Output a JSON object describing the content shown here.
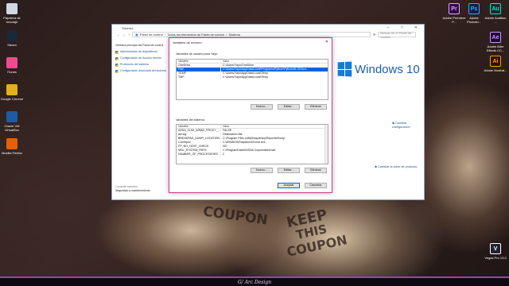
{
  "desktop": {
    "left_icons": [
      {
        "label": "Papelera de reciclaje",
        "icon": "recycle-bin-icon",
        "color": "#cfd8e3"
      },
      {
        "label": "Steam",
        "icon": "steam-icon",
        "color": "#1b2838"
      },
      {
        "label": "iTunes",
        "icon": "itunes-icon",
        "color": "#f04b8f"
      },
      {
        "label": "Google Chrome",
        "icon": "chrome-icon",
        "color": "#e3b21a"
      },
      {
        "label": "Oracle VM VirtualBox",
        "icon": "virtualbox-icon",
        "color": "#1f5aa6"
      },
      {
        "label": "Mozilla Firefox",
        "icon": "firefox-icon",
        "color": "#e66000"
      }
    ],
    "right_icons": [
      {
        "label": "Adobe Premiere P...",
        "glyph": "Pr",
        "color": "#2a0f47",
        "fg": "#e6a0ff"
      },
      {
        "label": "Adobe Photosh...",
        "glyph": "Ps",
        "color": "#0b2441",
        "fg": "#31a8ff"
      },
      {
        "label": "Adobe Audition ...",
        "glyph": "Au",
        "color": "#06332f",
        "fg": "#00e4bb"
      },
      {
        "label": "Adobe After Effects CC...",
        "glyph": "Ae",
        "color": "#1a0b35",
        "fg": "#d291ff"
      },
      {
        "label": "Adobe Illustrat...",
        "glyph": "Ai",
        "color": "#2e1300",
        "fg": "#ff9a00"
      },
      {
        "label": "Vegas Pro 13.0",
        "glyph": "V",
        "color": "#223",
        "fg": "#fff"
      }
    ],
    "wallpaper_words": [
      "KEEP",
      "THIS",
      "COUPON",
      "COUPON"
    ]
  },
  "taskbar": {
    "text": "G/ Arc Design"
  },
  "control_panel": {
    "title": "Sistema",
    "breadcrumb": [
      "Panel de control",
      "Todos los elementos de Panel de control",
      "Sistema"
    ],
    "search_placeholder": "Buscar en el Panel de control",
    "left_links": [
      {
        "label": "Ventana principal del Panel de control",
        "icon": ""
      },
      {
        "label": "Administrador de dispositivos",
        "icon": "shield-icon"
      },
      {
        "label": "Configuración de Acceso remoto",
        "icon": "shield-icon"
      },
      {
        "label": "Protección del sistema",
        "icon": "shield-icon"
      },
      {
        "label": "Configuración avanzada del sistema",
        "icon": "shield-icon"
      }
    ],
    "see_also": "Consulte también",
    "see_also_links": [
      "Seguridad y mantenimiento"
    ],
    "brand": "Windows 10",
    "change_config": "Cambiar configuración",
    "change_key": "Cambiar la clave de producto"
  },
  "env_dialog": {
    "title": "Variables de entorno",
    "user_group": "Variables de usuario para Yayo",
    "columns": [
      "Variable",
      "Valor"
    ],
    "user_vars": [
      {
        "name": "OneDrive",
        "value": "C:\\Users\\Yayo\\OneDrive",
        "selected": false
      },
      {
        "name": "Path",
        "value": "C:\\Users\\Yayo\\AppData\\Local\\Programs\\Python\\Python36-32\\Scri...",
        "selected": true
      },
      {
        "name": "TEMP",
        "value": "C:\\Users\\Yayo\\AppData\\Local\\Temp",
        "selected": false
      },
      {
        "name": "TMP",
        "value": "C:\\Users\\Yayo\\AppData\\Local\\Temp",
        "selected": false
      }
    ],
    "system_group": "Variables del sistema",
    "sys_vars": [
      {
        "name": "ASSA_CLIM_WRAD_PROXY_...",
        "value": "FALSE"
      },
      {
        "name": "asl.log",
        "value": "Destination=file"
      },
      {
        "name": "BREAKPAD_DUMP_LOCATION",
        "value": "C:\\Program Files (x86)\\Kaspersky\\Reports\\Dump"
      },
      {
        "name": "ComSpec",
        "value": "C:\\WINDOWS\\system32\\cmd.exe"
      },
      {
        "name": "FP_NO_HOST_CHECK",
        "value": "NO"
      },
      {
        "name": "MDL_SYSTEM_PATH",
        "value": "C:\\ProgramData\\NVIDIA Corporation\\mdl\\"
      },
      {
        "name": "NUMBER_OF_PROCESSORS",
        "value": "2"
      }
    ],
    "buttons": {
      "new": "Nuevo...",
      "edit": "Editar...",
      "delete": "Eliminar",
      "accept": "Aceptar",
      "cancel": "Cancelar"
    }
  }
}
